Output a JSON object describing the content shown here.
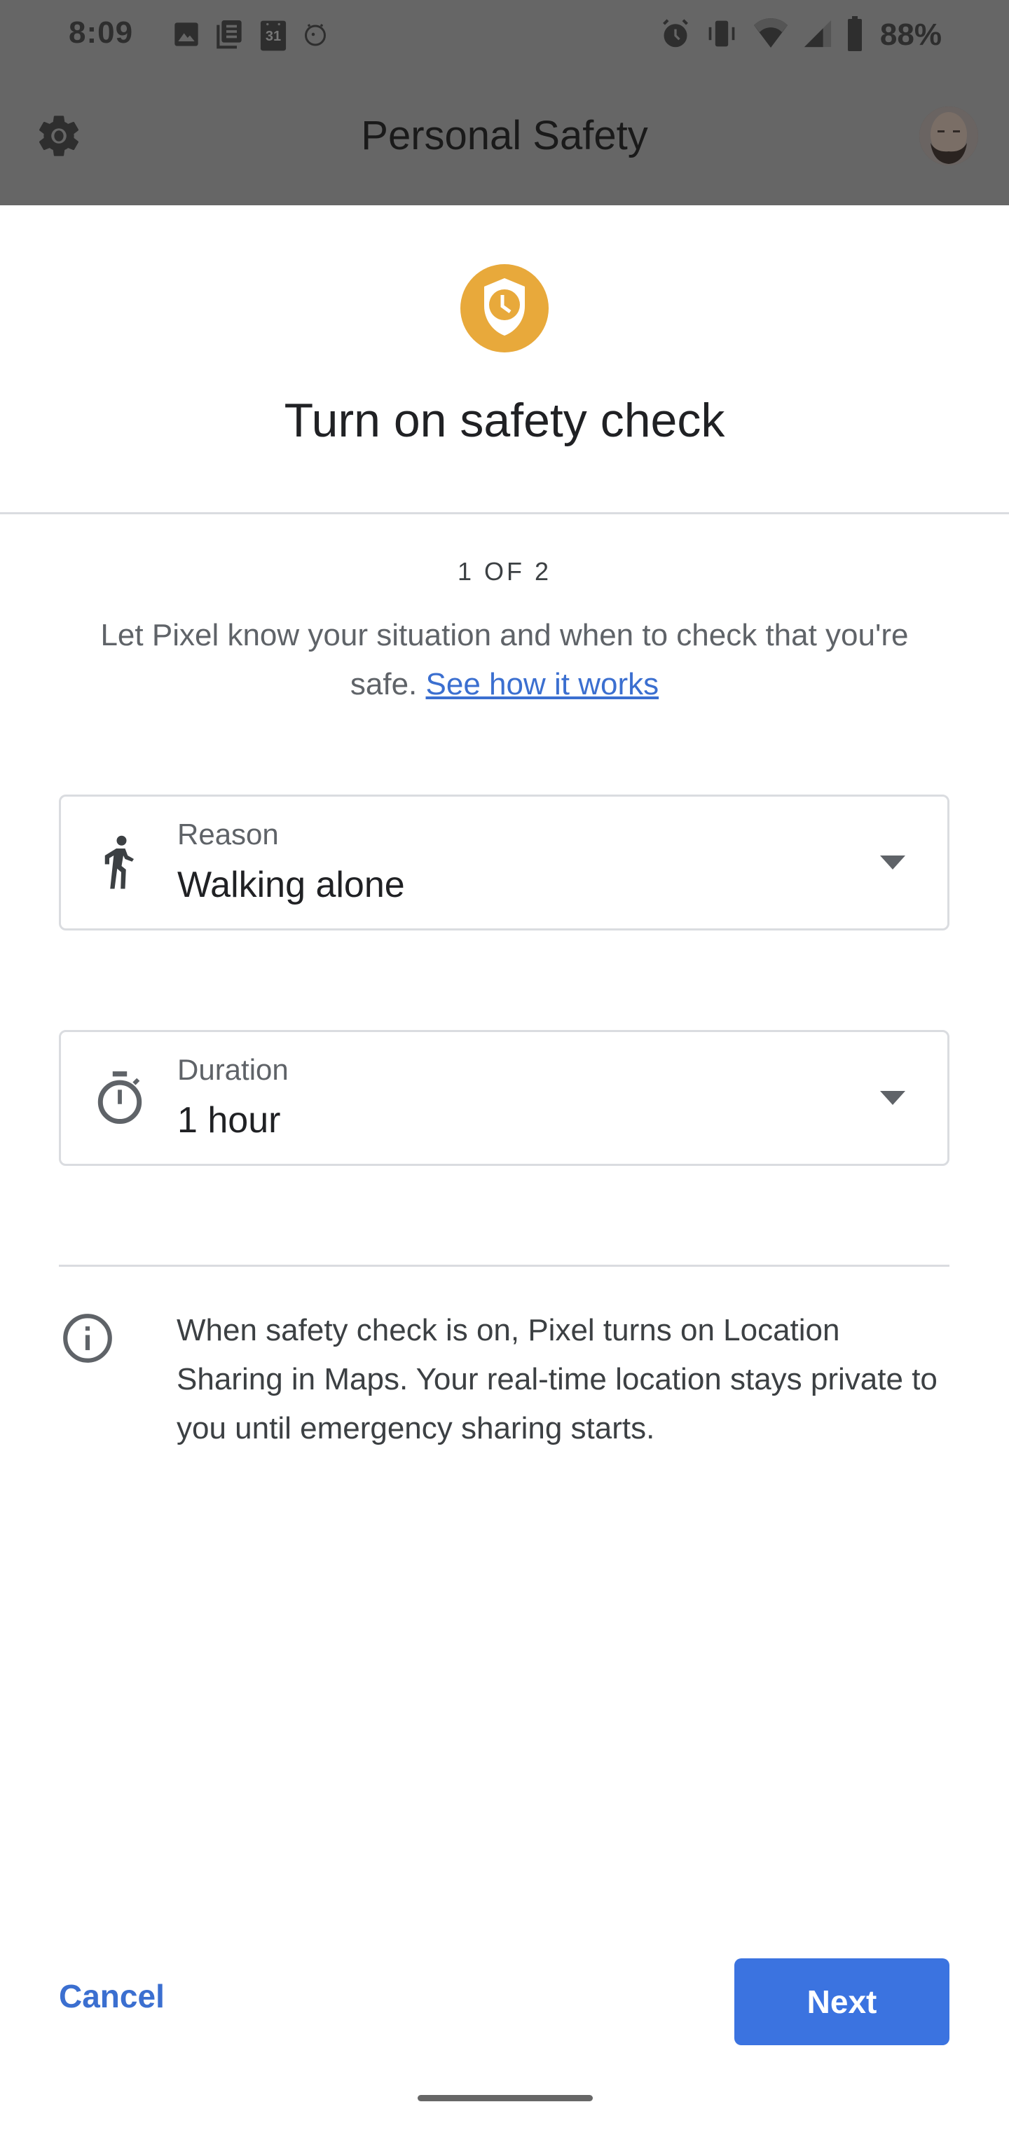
{
  "status_bar": {
    "time": "8:09",
    "left_icons": [
      "photo-icon",
      "news-icon",
      "calendar-icon",
      "digital-wellbeing-icon"
    ],
    "calendar_day": "31",
    "right_icons": [
      "alarm-icon",
      "vibrate-icon",
      "wifi-icon",
      "cell-signal-icon",
      "battery-icon"
    ],
    "battery_percent": "88%"
  },
  "header": {
    "title": "Personal Safety",
    "settings_icon": "gear-icon",
    "avatar": "user-avatar"
  },
  "hero": {
    "icon": "shield-clock-icon",
    "icon_color": "#e8a93b",
    "title": "Turn on safety check"
  },
  "step": {
    "label": "1 OF 2"
  },
  "description": {
    "text": "Let Pixel know your situation and when to check that you're safe. ",
    "link_label": "See how it works"
  },
  "fields": [
    {
      "icon": "walking-person-icon",
      "label": "Reason",
      "value": "Walking alone"
    },
    {
      "icon": "timer-icon",
      "label": "Duration",
      "value": "1 hour"
    }
  ],
  "info": {
    "icon": "info-icon",
    "text": "When safety check is on, Pixel turns on Location Sharing in Maps. Your real-time location stays private to you until emergency sharing starts."
  },
  "actions": {
    "cancel_label": "Cancel",
    "next_label": "Next",
    "accent_color": "#3b73e0"
  }
}
